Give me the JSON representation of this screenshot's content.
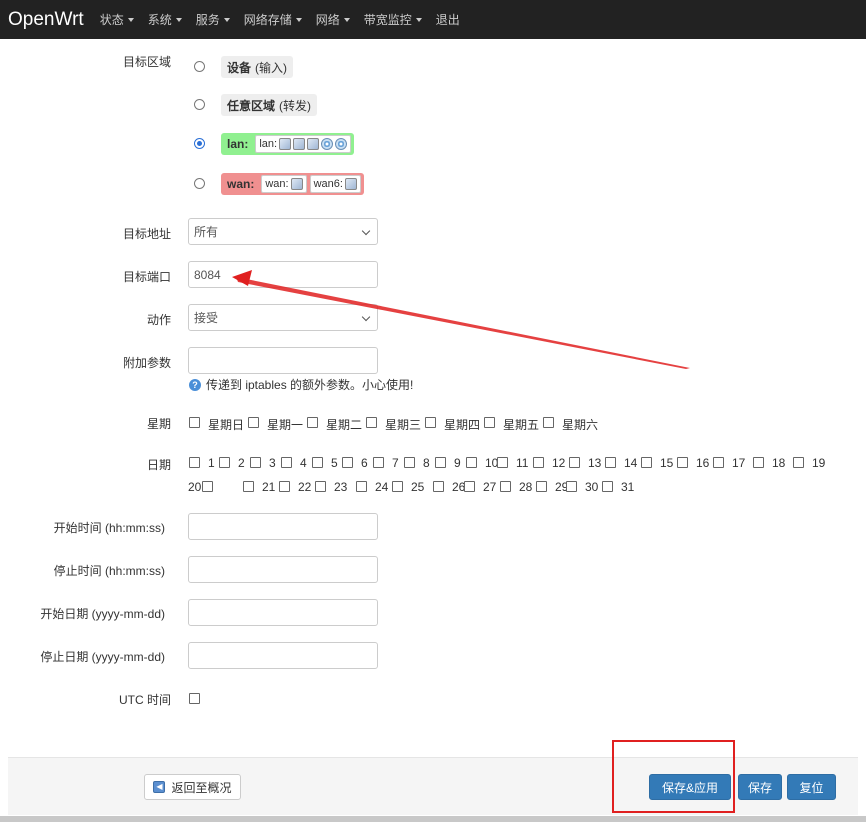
{
  "brand": "OpenWrt",
  "nav": [
    {
      "label": "状态",
      "dropdown": true
    },
    {
      "label": "系统",
      "dropdown": true
    },
    {
      "label": "服务",
      "dropdown": true
    },
    {
      "label": "网络存储",
      "dropdown": true
    },
    {
      "label": "网络",
      "dropdown": true
    },
    {
      "label": "带宽监控",
      "dropdown": true
    },
    {
      "label": "退出",
      "dropdown": false
    }
  ],
  "form": {
    "dest_zone_label": "目标区域",
    "zones": {
      "device": {
        "name": "设备",
        "sub": "(输入)",
        "checked": false
      },
      "any": {
        "name": "任意区域",
        "sub": "(转发)",
        "checked": false
      },
      "lan": {
        "name": "lan:",
        "ifaces": [
          {
            "label": "lan:"
          }
        ],
        "checked": true,
        "color": "#90f090"
      },
      "wan": {
        "name": "wan:",
        "ifaces": [
          {
            "label": "wan:"
          },
          {
            "label": "wan6:"
          }
        ],
        "checked": false,
        "color": "#f09090"
      }
    },
    "dest_addr_label": "目标地址",
    "dest_addr_value": "所有",
    "dest_port_label": "目标端口",
    "dest_port_value": "8084",
    "action_label": "动作",
    "action_value": "接受",
    "extra_label": "附加参数",
    "extra_value": "",
    "extra_hint": "传递到 iptables 的额外参数。小心使用!",
    "weekday_label": "星期",
    "weekdays": [
      "星期日",
      "星期一",
      "星期二",
      "星期三",
      "星期四",
      "星期五",
      "星期六"
    ],
    "monthday_label": "日期",
    "monthdays": [
      "1",
      "2",
      "3",
      "4",
      "5",
      "6",
      "7",
      "8",
      "9",
      "10",
      "11",
      "12",
      "13",
      "14",
      "15",
      "16",
      "17",
      "18",
      "19",
      "20",
      "21",
      "22",
      "23",
      "24",
      "25",
      "26",
      "27",
      "28",
      "29",
      "30",
      "31"
    ],
    "start_time_label": "开始时间 (hh:mm:ss)",
    "stop_time_label": "停止时间 (hh:mm:ss)",
    "start_date_label": "开始日期 (yyyy-mm-dd)",
    "stop_date_label": "停止日期 (yyyy-mm-dd)",
    "utc_label": "UTC 时间"
  },
  "footer": {
    "back_label": "返回至概况",
    "save_apply_label": "保存&应用",
    "save_label": "保存",
    "reset_label": "复位"
  },
  "annotation_color": "#e02020"
}
